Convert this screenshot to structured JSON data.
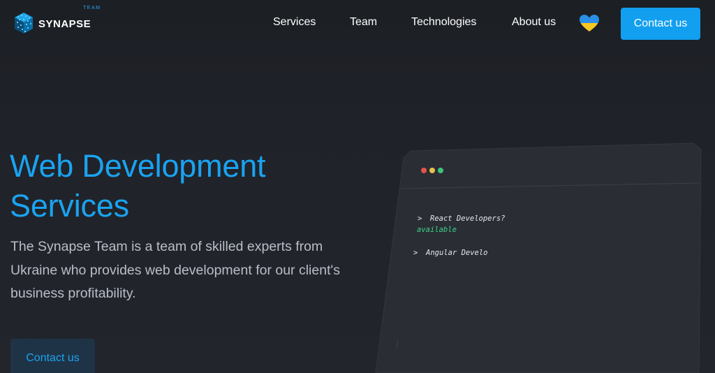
{
  "header": {
    "logo_text": "SYNAPSE",
    "logo_subtext": "TEAM",
    "nav": {
      "services": "Services",
      "team": "Team",
      "technologies": "Technologies",
      "about": "About us"
    },
    "contact_label": "Contact us"
  },
  "hero": {
    "title_line1": "Web Development",
    "title_line2": "Services",
    "description": "The Synapse Team is a team of skilled experts from Ukraine who provides web development for our client's business profitability.",
    "contact_label": "Contact us"
  },
  "terminal": {
    "prompt_symbol": ">",
    "line1_query": "React Developers?",
    "line1_answer": "available",
    "line2_query": "Angular Develo"
  },
  "colors": {
    "accent": "#129ff0",
    "title": "#1aa3f0",
    "background": "#1f2227",
    "terminal_bg": "#2a2d34",
    "dot_red": "#e5534b",
    "dot_yellow": "#e5c248",
    "dot_green": "#3dc47e",
    "success_text": "#3dd68c"
  },
  "icons": {
    "logo": "synapse-cube-logo-icon",
    "heart": "ukraine-heart-icon"
  }
}
